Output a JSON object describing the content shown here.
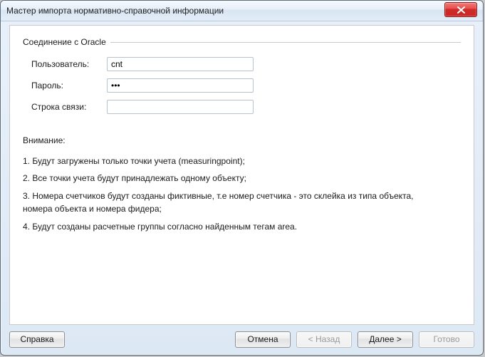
{
  "window": {
    "title": "Мастер импорта нормативно-справочной информации"
  },
  "group": {
    "legend": "Соединение с Oracle"
  },
  "form": {
    "user": {
      "label": "Пользователь:",
      "value": "cnt"
    },
    "password": {
      "label": "Пароль:",
      "value": "•••"
    },
    "connstr": {
      "label": "Строка связи:",
      "value": ""
    }
  },
  "notice": {
    "title": "Внимание:",
    "items": [
      "1. Будут загружены только точки учета (measuringpoint);",
      "2. Все точки учета будут принадлежать одному объекту;",
      "3. Номера счетчиков будут созданы фиктивные, т.е номер счетчика - это склейка из типа объекта, номера объекта и номера фидера;",
      "4. Будут созданы расчетные группы согласно найденным тегам area."
    ]
  },
  "buttons": {
    "help": "Справка",
    "cancel": "Отмена",
    "back": "< Назад",
    "next": "Далее >",
    "finish": "Готово"
  },
  "state": {
    "back_enabled": false,
    "finish_enabled": false
  }
}
